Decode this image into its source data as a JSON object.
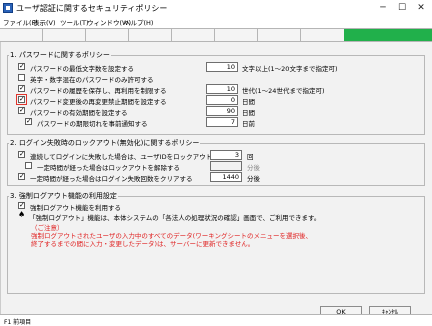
{
  "window": {
    "title": "ユーザ認証に関するセキュリティポリシー",
    "controls": {
      "minimize": "─",
      "maximize": "☐",
      "close": "✕"
    }
  },
  "menu": {
    "items": [
      "ファイル(F)",
      "表示(V)",
      "ツール(T)",
      "ウィンドウ(W)",
      "ヘルプ(H)"
    ]
  },
  "section1": {
    "title": "1. パスワードに関するポリシー",
    "rows": [
      {
        "label": "パスワードの最低文字数を設定する",
        "checked": true,
        "value": "10",
        "unit": "文字以上(1～20文字まで指定可)"
      },
      {
        "label": "英字・数字混在のパスワードのみ許可する",
        "checked": false
      },
      {
        "label": "パスワードの履歴を保存し、再利用を制限する",
        "checked": true,
        "value": "10",
        "unit": "世代(1～24世代まで指定可)"
      },
      {
        "label": "パスワード変更後の再変更禁止期間を設定する",
        "checked": true,
        "value": "0",
        "unit": "日間"
      },
      {
        "label": "パスワードの有効期間を設定する",
        "checked": true,
        "value": "90",
        "unit": "日間"
      },
      {
        "label": "パスワードの期限切れを事前通知する",
        "checked": true,
        "value": "7",
        "unit": "日前"
      }
    ]
  },
  "section2": {
    "title": "2. ログイン失敗時のロックアウト(無効化)に関するポリシー",
    "rows": [
      {
        "label": "連続してログインに失敗した場合は、ユーザIDをロックアウトする",
        "checked": true,
        "value": "3",
        "unit": "回"
      },
      {
        "label": "一定時間が経った場合はロックアウトを解除する",
        "checked": false,
        "value": "",
        "unit": "分後"
      },
      {
        "label": "一定時間が経った場合はログイン失敗回数をクリアする",
        "checked": true,
        "value": "1440",
        "unit": "分後"
      }
    ]
  },
  "section3": {
    "title": "3. 強制ログアウト機能の利用設定",
    "row": {
      "label": "強制ログアウト機能を利用する",
      "checked": true
    },
    "desc": "「強制ログアウト」機能は、本体システムの「各法人の処理状況の確認」画面で、ご利用できます。",
    "note_title": "（ご注意）",
    "note_line1": "強制ログアウトされたユーザの入力中のすべてのデータ(ワーキングシートのメニューを選択後、",
    "note_line2": "終了するまでの間に入力・変更したデータ)は、サーバーに更新できません。"
  },
  "buttons": {
    "ok": "OK",
    "cancel": "ｷｬﾝｾﾙ"
  },
  "statusbar": {
    "text": "F1 前項目"
  },
  "colors": {
    "green": "#21b04b",
    "note_red": "#e02222",
    "focus": "#e0342c"
  }
}
